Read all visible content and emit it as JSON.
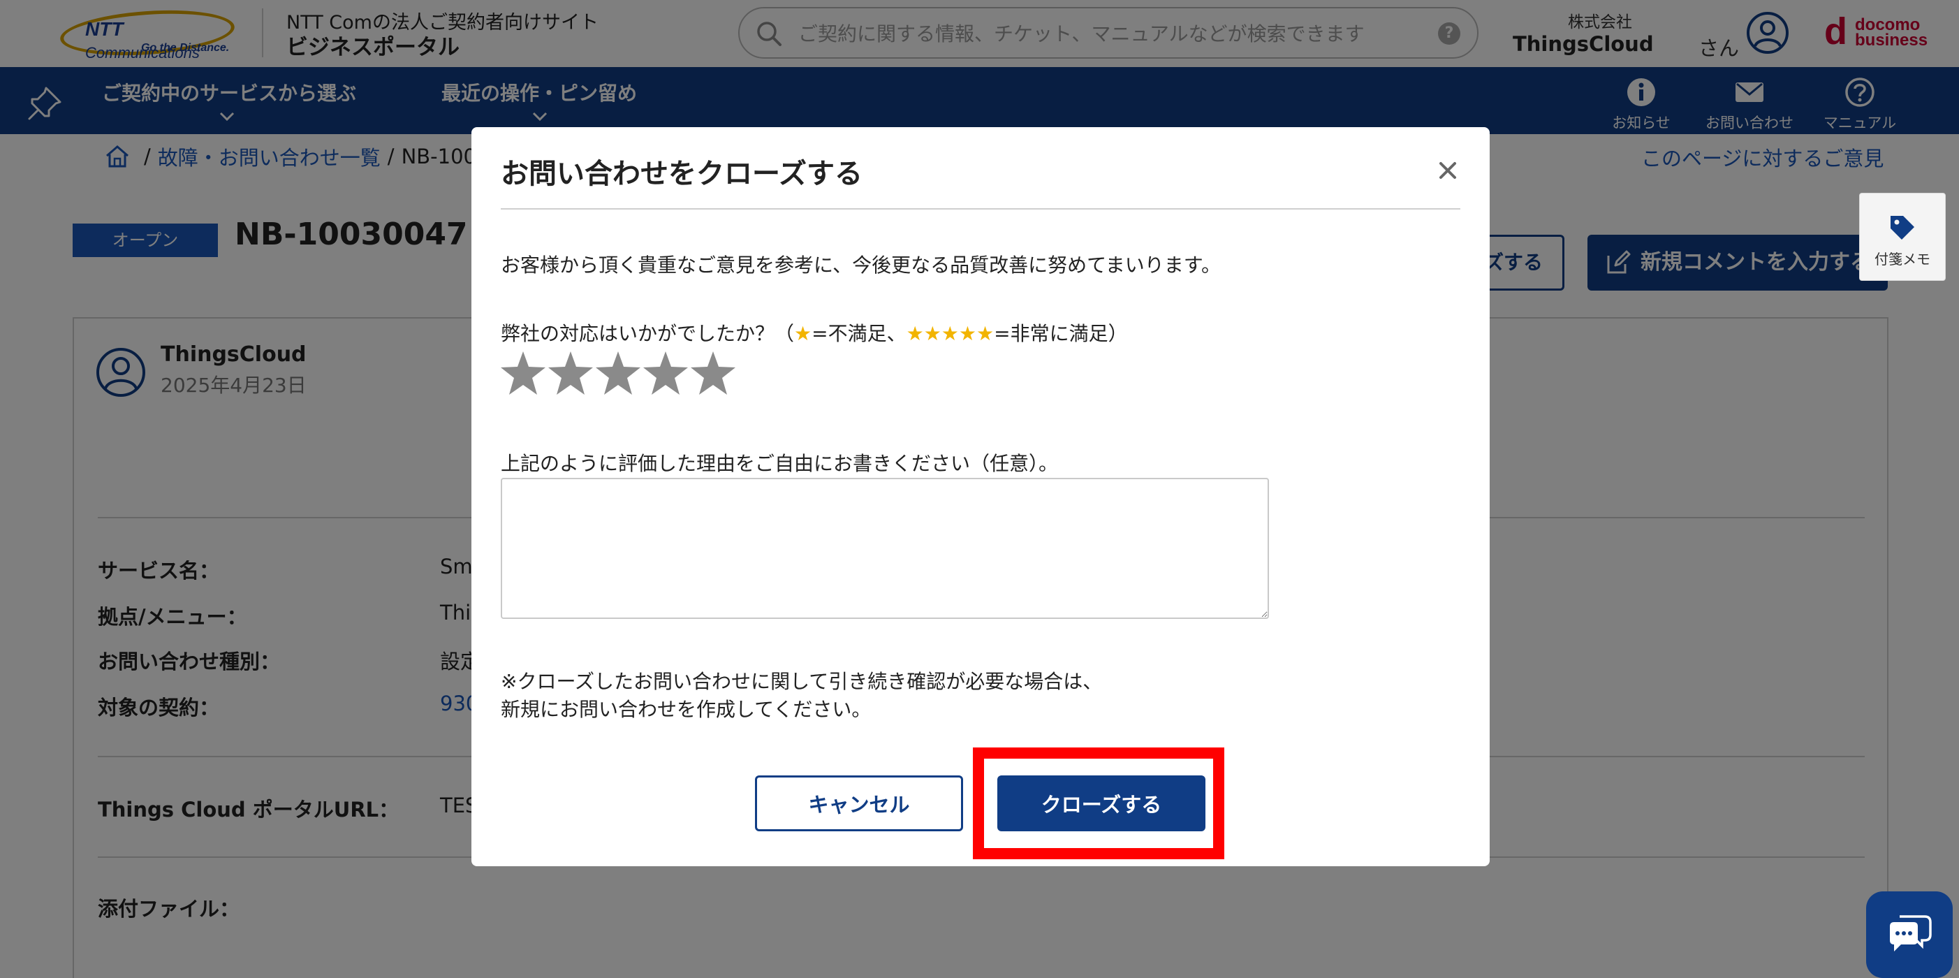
{
  "header": {
    "logo_brand": "NTT",
    "logo_brand_rest": "Communications",
    "logo_tagline": "Go the Distance.",
    "site_subtitle": "NTT Comの法人ご契約者向けサイト",
    "site_title": "ビジネスポータル",
    "search_placeholder": "ご契約に関する情報、チケット、マニュアルなどが検索できます",
    "company_prefix": "株式会社",
    "company_name": "ThingsCloud",
    "honorific": "さん",
    "docomo_mark": "d",
    "docomo_line1": "docomo",
    "docomo_line2": "business"
  },
  "nav": {
    "items": [
      {
        "label": "ご契約中のサービスから選ぶ"
      },
      {
        "label": "最近の操作・ピン留め"
      }
    ],
    "tools": [
      {
        "label": "お知らせ",
        "icon": "info-icon"
      },
      {
        "label": "お問い合わせ",
        "icon": "mail-icon"
      },
      {
        "label": "マニュアル",
        "icon": "help-icon"
      }
    ]
  },
  "breadcrumb": {
    "sep1": "/",
    "link": "故障・お問い合わせ一覧",
    "sep2": "/",
    "current": "NB-100"
  },
  "page": {
    "feedback_link": "このページに対するご意見",
    "status": "オープン",
    "ticket_id": "NB-10030047",
    "close_button_visible": "ズする",
    "new_comment_button": "新規コメントを入力する",
    "sticky_note": "付箋メモ",
    "author": "ThingsCloud",
    "date": "2025年4月23日",
    "fields": [
      {
        "label": "サービス名：",
        "value": "Sm"
      },
      {
        "label": "拠点/メニュー：",
        "value": "Thi"
      },
      {
        "label": "お問い合わせ種別：",
        "value": "設定"
      },
      {
        "label": "対象の契約：",
        "value": "930"
      },
      {
        "label": "Things Cloud ポータルURL：",
        "value": "TES"
      },
      {
        "label": "添付ファイル：",
        "value": ""
      }
    ]
  },
  "modal": {
    "title": "お問い合わせをクローズする",
    "close_glyph": "×",
    "intro": "お客様から頂く貴重なご意見を参考に、今後更なる品質改善に努めてまいります。",
    "rating_q_part1": "弊社の対応はいかがでしたか？（",
    "rating_q_star1": "★",
    "rating_q_part2": "=不満足、",
    "rating_q_star5": "★★★★★",
    "rating_q_part3": "=非常に満足）",
    "rating_value": 0,
    "rating_max": 5,
    "reason_label": "上記のように評価した理由をご自由にお書きください（任意）。",
    "reason_value": "",
    "note_line1": "※クローズしたお問い合わせに関して引き続き確認が必要な場合は、",
    "note_line2": "新規にお問い合わせを作成してください。",
    "cancel_label": "キャンセル",
    "confirm_label": "クローズする"
  },
  "colors": {
    "brand_navy": "#103d85",
    "link_blue": "#1a56b8",
    "star_gold": "#f2b400",
    "star_empty": "#8a8a8a",
    "highlight_red": "#ff0000"
  }
}
